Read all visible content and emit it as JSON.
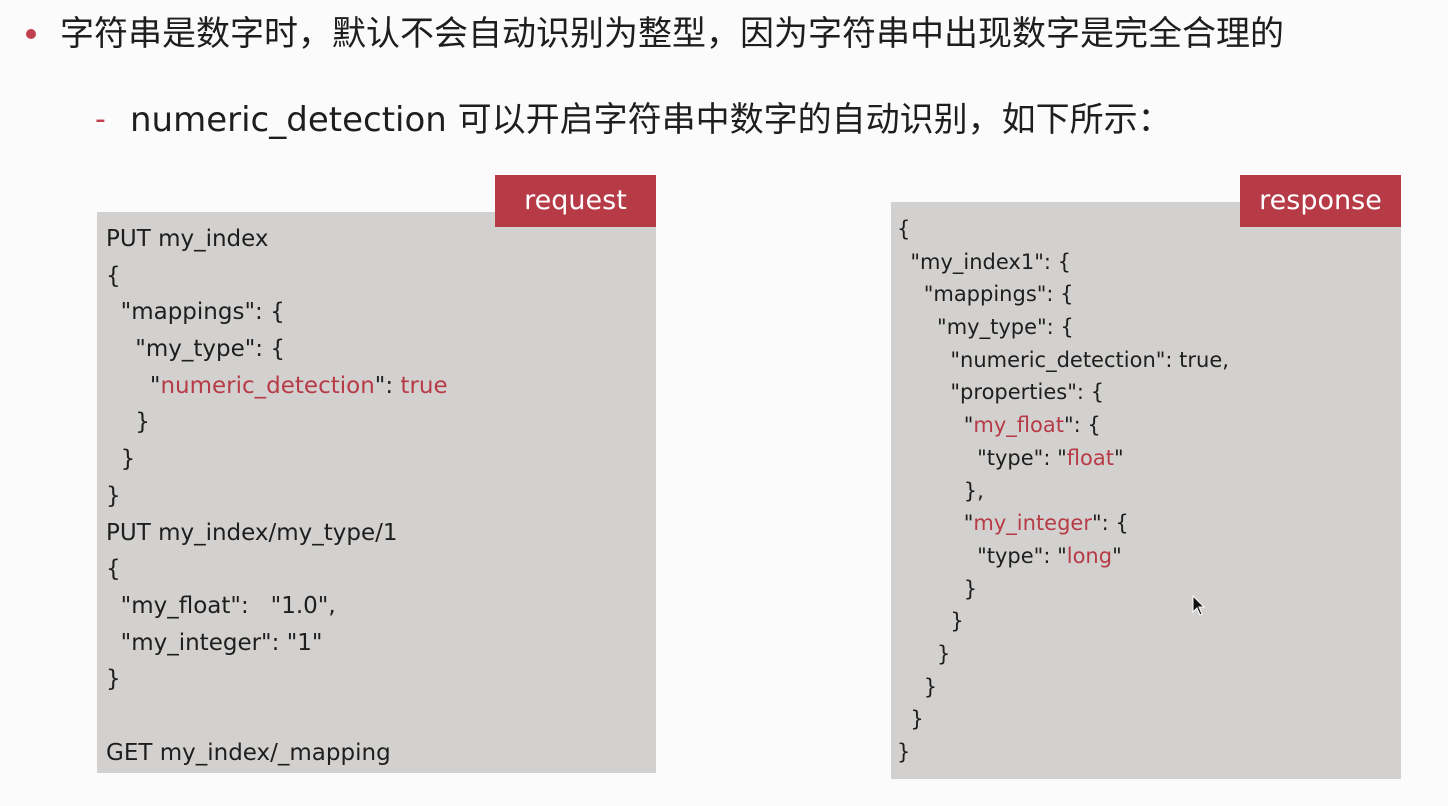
{
  "bullet": {
    "main_text": "字符串是数字时，默认不会自动识别为整型，因为字符串中出现数字是完全合理的",
    "sub_dash": "-",
    "sub_text": "numeric_detection 可以开启字符串中数字的自动识别，如下所示："
  },
  "request": {
    "tag": "request",
    "lines": [
      [
        "PUT my_index"
      ],
      [
        "{"
      ],
      [
        "  \"mappings\": {"
      ],
      [
        "    \"my_type\": {"
      ],
      [
        "      \"",
        "numeric_detection",
        "\": ",
        "true"
      ],
      [
        "    }"
      ],
      [
        "  }"
      ],
      [
        "}"
      ],
      [
        "PUT my_index/my_type/1"
      ],
      [
        "{"
      ],
      [
        "  \"my_float\":   \"1.0\","
      ],
      [
        "  \"my_integer\": \"1\""
      ],
      [
        "}"
      ],
      [
        ""
      ],
      [
        "GET my_index/_mapping"
      ]
    ]
  },
  "response": {
    "tag": "response",
    "lines": [
      [
        "{"
      ],
      [
        "  \"my_index1\": {"
      ],
      [
        "    \"mappings\": {"
      ],
      [
        "      \"my_type\": {"
      ],
      [
        "        \"numeric_detection\": true,"
      ],
      [
        "        \"properties\": {"
      ],
      [
        "          \"",
        "my_float",
        "\": {"
      ],
      [
        "            \"type\": \"",
        "float",
        "\""
      ],
      [
        "          },"
      ],
      [
        "          \"",
        "my_integer",
        "\": {"
      ],
      [
        "            \"type\": \"",
        "long",
        "\""
      ],
      [
        "          }"
      ],
      [
        "        }"
      ],
      [
        "      }"
      ],
      [
        "    }"
      ],
      [
        "  }"
      ],
      [
        "}"
      ]
    ]
  },
  "colors": {
    "accent": "#b73b47",
    "panel": "#d3d1cf",
    "background": "#fbfbfb",
    "text": "#1e1e1e"
  }
}
